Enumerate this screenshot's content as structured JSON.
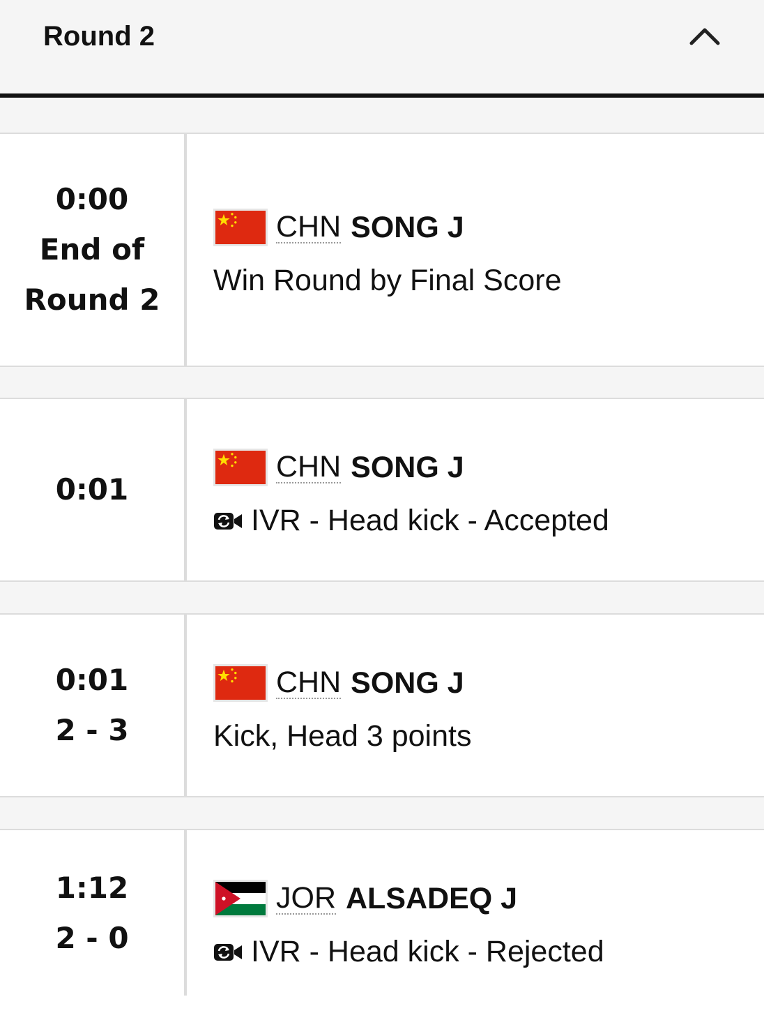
{
  "header": {
    "title": "Round 2",
    "toggle_icon": "chevron-up-icon"
  },
  "events": [
    {
      "time": "0:00",
      "extra": [
        "End of",
        "Round 2"
      ],
      "noc": "CHN",
      "athlete": "SONG J",
      "flag": "china-flag",
      "action_icon": "",
      "action": "Win Round by Final Score"
    },
    {
      "time": "0:01",
      "extra": [],
      "noc": "CHN",
      "athlete": "SONG J",
      "flag": "china-flag",
      "action_icon": "video-review-icon",
      "action": "IVR - Head kick - Accepted"
    },
    {
      "time": "0:01",
      "extra": [
        "2 - 3"
      ],
      "noc": "CHN",
      "athlete": "SONG J",
      "flag": "china-flag",
      "action_icon": "",
      "action": "Kick, Head 3 points"
    },
    {
      "time": "1:12",
      "extra": [
        "2 - 0"
      ],
      "noc": "JOR",
      "athlete": "ALSADEQ J",
      "flag": "jordan-flag",
      "action_icon": "video-review-icon",
      "action": "IVR - Head kick - Rejected"
    }
  ],
  "colors": {
    "china_red": "#de2910",
    "china_star": "#ffde00",
    "jordan_black": "#000000",
    "jordan_white": "#ffffff",
    "jordan_green": "#007a3d",
    "jordan_red": "#ce1126"
  }
}
